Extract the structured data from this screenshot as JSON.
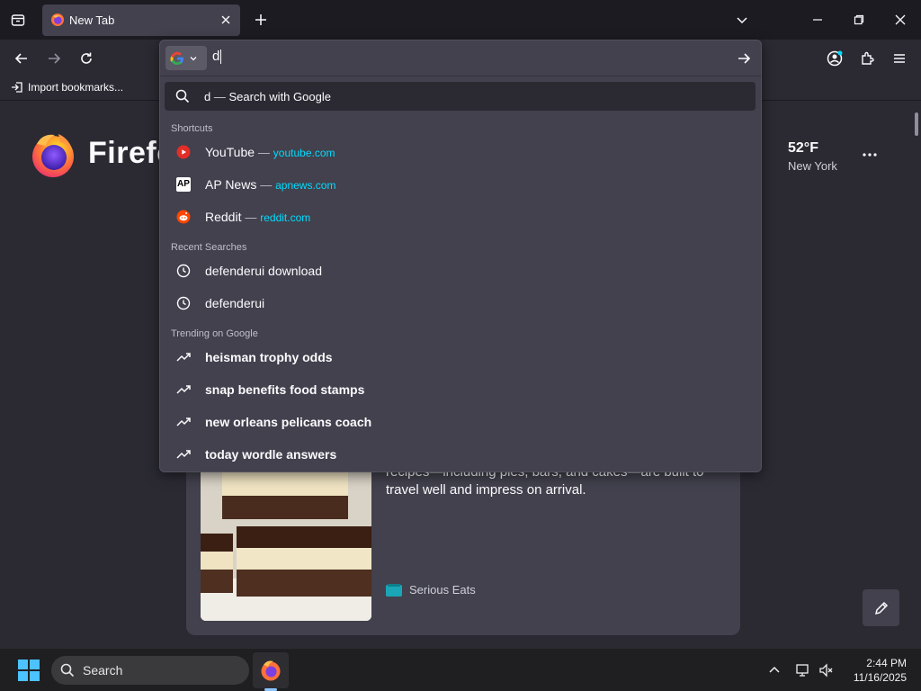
{
  "tab": {
    "title": "New Tab"
  },
  "bookmarks": {
    "import_label": "Import bookmarks..."
  },
  "newtab": {
    "wordmark": "Firefox",
    "weather": {
      "temp": "52°F",
      "location": "New York"
    },
    "card": {
      "text": "recipes—including pies, bars, and cakes—are built to travel well and impress on arrival.",
      "source": "Serious Eats"
    }
  },
  "urlbar": {
    "value": "d",
    "heuristic": {
      "query": "d",
      "sep": "—",
      "action": "Search with Google"
    },
    "groups": {
      "shortcuts": "Shortcuts",
      "recent": "Recent Searches",
      "trending": "Trending on Google"
    },
    "shortcuts": [
      {
        "title": "YouTube",
        "url": "youtube.com"
      },
      {
        "title": "AP News",
        "url": "apnews.com"
      },
      {
        "title": "Reddit",
        "url": "reddit.com"
      }
    ],
    "recent": [
      {
        "title": "defenderui download"
      },
      {
        "title": "defenderui"
      }
    ],
    "trending": [
      {
        "title": "heisman trophy odds"
      },
      {
        "title": "snap benefits food stamps"
      },
      {
        "title": "new orleans pelicans coach"
      },
      {
        "title": "today wordle answers"
      }
    ],
    "dash": "—",
    "ap_badge": "AP"
  },
  "taskbar": {
    "search_label": "Search",
    "time": "2:44 PM",
    "date": "11/16/2025"
  },
  "colors": {
    "accent": "#00ddff",
    "chrome_dark": "#1c1b22",
    "panel": "#42414d"
  },
  "icons": [
    "tab-list-icon",
    "firefox-icon",
    "close-icon",
    "plus-icon",
    "chevron-down-icon",
    "minimize-icon",
    "maximize-icon",
    "back-icon",
    "forward-icon",
    "reload-icon",
    "google-icon",
    "arrow-right-icon",
    "account-icon",
    "extensions-icon",
    "hamburger-menu-icon",
    "search-icon",
    "history-icon",
    "trending-icon",
    "youtube-icon",
    "reddit-icon",
    "pencil-icon",
    "windows-start-icon"
  ]
}
